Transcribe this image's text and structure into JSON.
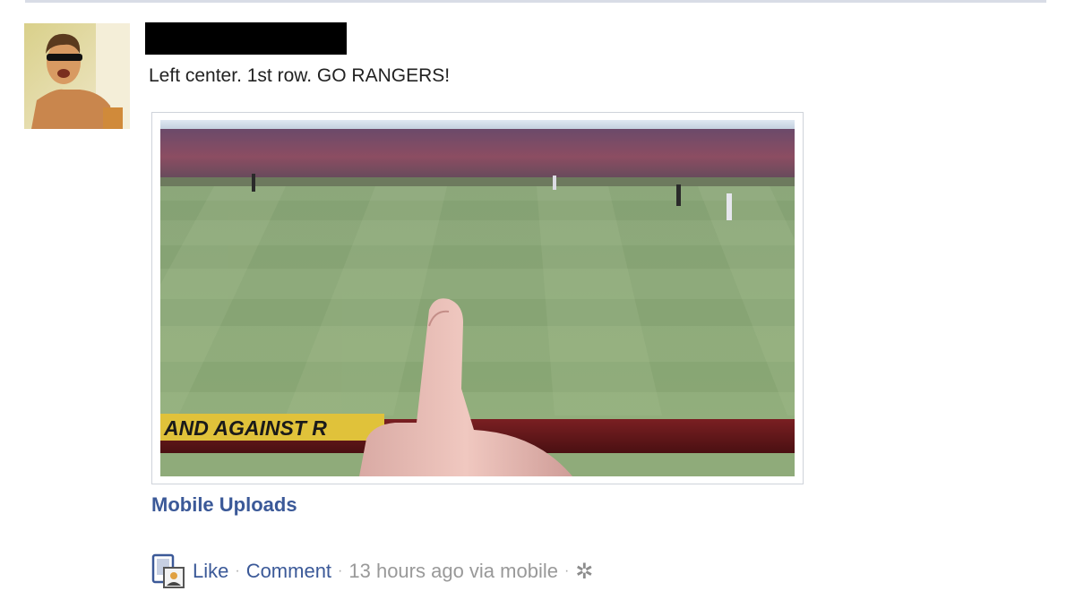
{
  "post": {
    "text": "Left center.  1st row.  GO RANGERS!",
    "album_link": "Mobile Uploads",
    "photo": {
      "banner_text": "AND AGAINST R"
    },
    "actions": {
      "like": "Like",
      "comment": "Comment",
      "timestamp": "13 hours ago via mobile",
      "settings_icon": "gear-icon",
      "source_icon": "mobile-upload-icon"
    }
  },
  "colors": {
    "link": "#3b5998",
    "meta_text": "#999999",
    "frame_border": "#cfd3da"
  }
}
